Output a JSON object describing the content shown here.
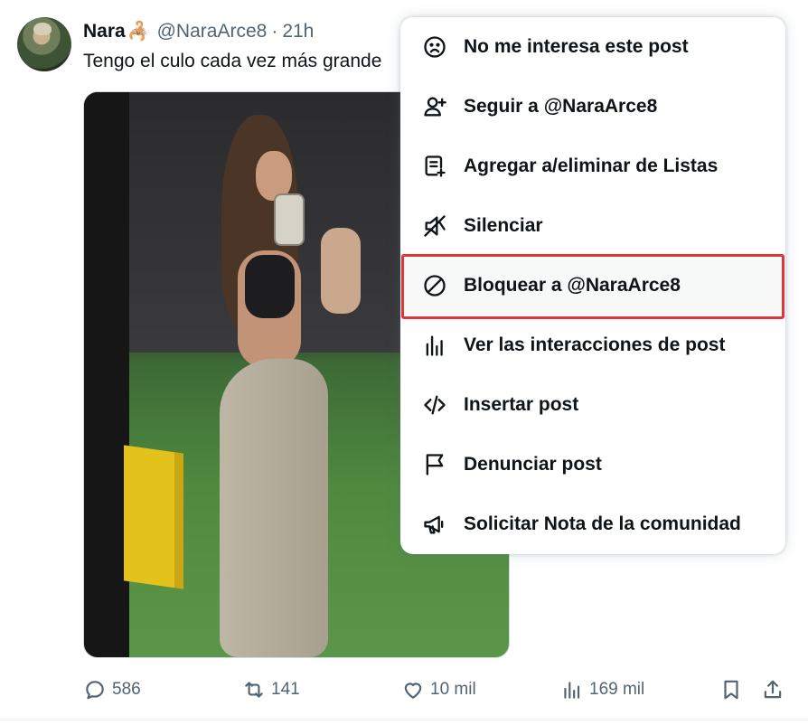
{
  "post": {
    "display_name": "Nara",
    "name_emoji": "🦂",
    "handle": "@NaraArce8",
    "separator": "·",
    "time": "21h",
    "text": "Tengo el culo cada vez más grande"
  },
  "actions": {
    "replies": "586",
    "reposts": "141",
    "likes": "10 mil",
    "views": "169 mil"
  },
  "menu": {
    "items": [
      {
        "label": "No me interesa este post",
        "icon": "sad-face-icon"
      },
      {
        "label": "Seguir a @NaraArce8",
        "icon": "follow-user-icon"
      },
      {
        "label": "Agregar a/eliminar de Listas",
        "icon": "list-add-icon"
      },
      {
        "label": "Silenciar",
        "icon": "mute-icon"
      },
      {
        "label": "Bloquear a @NaraArce8",
        "icon": "block-icon",
        "highlighted": true
      },
      {
        "label": "Ver las interacciones de post",
        "icon": "analytics-icon"
      },
      {
        "label": "Insertar post",
        "icon": "embed-code-icon"
      },
      {
        "label": "Denunciar post",
        "icon": "flag-icon"
      },
      {
        "label": "Solicitar Nota de la comunidad",
        "icon": "megaphone-icon"
      }
    ]
  },
  "colors": {
    "text_primary": "#0f1419",
    "text_secondary": "#536471",
    "highlight_outline": "#e0353b"
  }
}
